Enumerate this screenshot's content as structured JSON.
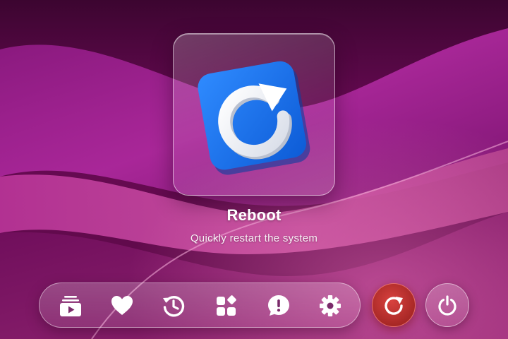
{
  "focused_app": {
    "title": "Reboot",
    "description": "Quickly restart the system",
    "icon": "reboot-icon",
    "icon_color": "#1f74e8"
  },
  "dock": {
    "items": [
      {
        "icon": "media-library-icon"
      },
      {
        "icon": "favorites-heart-icon"
      },
      {
        "icon": "history-icon"
      },
      {
        "icon": "apps-grid-icon"
      },
      {
        "icon": "feedback-icon"
      },
      {
        "icon": "settings-gear-icon"
      }
    ]
  },
  "system_buttons": [
    {
      "icon": "reboot-icon",
      "state": "selected",
      "color": "#c9312e"
    },
    {
      "icon": "power-icon",
      "state": "normal"
    }
  ],
  "colors": {
    "wallpaper_base": "#4a0737",
    "wallpaper_accent": "#a3208f",
    "text": "#ffffff"
  }
}
